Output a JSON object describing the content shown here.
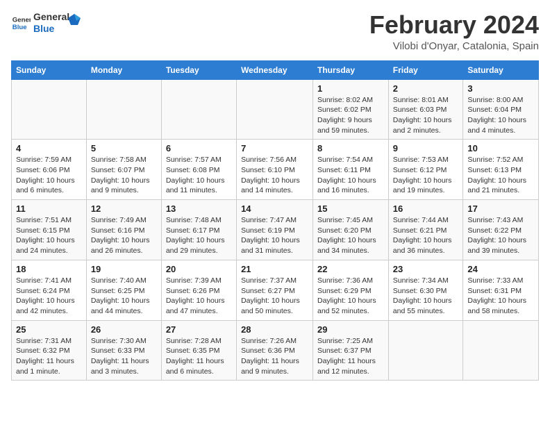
{
  "logo": {
    "text_general": "General",
    "text_blue": "Blue"
  },
  "header": {
    "title": "February 2024",
    "subtitle": "Vilobi d'Onyar, Catalonia, Spain"
  },
  "weekdays": [
    "Sunday",
    "Monday",
    "Tuesday",
    "Wednesday",
    "Thursday",
    "Friday",
    "Saturday"
  ],
  "weeks": [
    [
      {
        "day": "",
        "detail": ""
      },
      {
        "day": "",
        "detail": ""
      },
      {
        "day": "",
        "detail": ""
      },
      {
        "day": "",
        "detail": ""
      },
      {
        "day": "1",
        "detail": "Sunrise: 8:02 AM\nSunset: 6:02 PM\nDaylight: 9 hours and 59 minutes."
      },
      {
        "day": "2",
        "detail": "Sunrise: 8:01 AM\nSunset: 6:03 PM\nDaylight: 10 hours and 2 minutes."
      },
      {
        "day": "3",
        "detail": "Sunrise: 8:00 AM\nSunset: 6:04 PM\nDaylight: 10 hours and 4 minutes."
      }
    ],
    [
      {
        "day": "4",
        "detail": "Sunrise: 7:59 AM\nSunset: 6:06 PM\nDaylight: 10 hours and 6 minutes."
      },
      {
        "day": "5",
        "detail": "Sunrise: 7:58 AM\nSunset: 6:07 PM\nDaylight: 10 hours and 9 minutes."
      },
      {
        "day": "6",
        "detail": "Sunrise: 7:57 AM\nSunset: 6:08 PM\nDaylight: 10 hours and 11 minutes."
      },
      {
        "day": "7",
        "detail": "Sunrise: 7:56 AM\nSunset: 6:10 PM\nDaylight: 10 hours and 14 minutes."
      },
      {
        "day": "8",
        "detail": "Sunrise: 7:54 AM\nSunset: 6:11 PM\nDaylight: 10 hours and 16 minutes."
      },
      {
        "day": "9",
        "detail": "Sunrise: 7:53 AM\nSunset: 6:12 PM\nDaylight: 10 hours and 19 minutes."
      },
      {
        "day": "10",
        "detail": "Sunrise: 7:52 AM\nSunset: 6:13 PM\nDaylight: 10 hours and 21 minutes."
      }
    ],
    [
      {
        "day": "11",
        "detail": "Sunrise: 7:51 AM\nSunset: 6:15 PM\nDaylight: 10 hours and 24 minutes."
      },
      {
        "day": "12",
        "detail": "Sunrise: 7:49 AM\nSunset: 6:16 PM\nDaylight: 10 hours and 26 minutes."
      },
      {
        "day": "13",
        "detail": "Sunrise: 7:48 AM\nSunset: 6:17 PM\nDaylight: 10 hours and 29 minutes."
      },
      {
        "day": "14",
        "detail": "Sunrise: 7:47 AM\nSunset: 6:19 PM\nDaylight: 10 hours and 31 minutes."
      },
      {
        "day": "15",
        "detail": "Sunrise: 7:45 AM\nSunset: 6:20 PM\nDaylight: 10 hours and 34 minutes."
      },
      {
        "day": "16",
        "detail": "Sunrise: 7:44 AM\nSunset: 6:21 PM\nDaylight: 10 hours and 36 minutes."
      },
      {
        "day": "17",
        "detail": "Sunrise: 7:43 AM\nSunset: 6:22 PM\nDaylight: 10 hours and 39 minutes."
      }
    ],
    [
      {
        "day": "18",
        "detail": "Sunrise: 7:41 AM\nSunset: 6:24 PM\nDaylight: 10 hours and 42 minutes."
      },
      {
        "day": "19",
        "detail": "Sunrise: 7:40 AM\nSunset: 6:25 PM\nDaylight: 10 hours and 44 minutes."
      },
      {
        "day": "20",
        "detail": "Sunrise: 7:39 AM\nSunset: 6:26 PM\nDaylight: 10 hours and 47 minutes."
      },
      {
        "day": "21",
        "detail": "Sunrise: 7:37 AM\nSunset: 6:27 PM\nDaylight: 10 hours and 50 minutes."
      },
      {
        "day": "22",
        "detail": "Sunrise: 7:36 AM\nSunset: 6:29 PM\nDaylight: 10 hours and 52 minutes."
      },
      {
        "day": "23",
        "detail": "Sunrise: 7:34 AM\nSunset: 6:30 PM\nDaylight: 10 hours and 55 minutes."
      },
      {
        "day": "24",
        "detail": "Sunrise: 7:33 AM\nSunset: 6:31 PM\nDaylight: 10 hours and 58 minutes."
      }
    ],
    [
      {
        "day": "25",
        "detail": "Sunrise: 7:31 AM\nSunset: 6:32 PM\nDaylight: 11 hours and 1 minute."
      },
      {
        "day": "26",
        "detail": "Sunrise: 7:30 AM\nSunset: 6:33 PM\nDaylight: 11 hours and 3 minutes."
      },
      {
        "day": "27",
        "detail": "Sunrise: 7:28 AM\nSunset: 6:35 PM\nDaylight: 11 hours and 6 minutes."
      },
      {
        "day": "28",
        "detail": "Sunrise: 7:26 AM\nSunset: 6:36 PM\nDaylight: 11 hours and 9 minutes."
      },
      {
        "day": "29",
        "detail": "Sunrise: 7:25 AM\nSunset: 6:37 PM\nDaylight: 11 hours and 12 minutes."
      },
      {
        "day": "",
        "detail": ""
      },
      {
        "day": "",
        "detail": ""
      }
    ]
  ]
}
